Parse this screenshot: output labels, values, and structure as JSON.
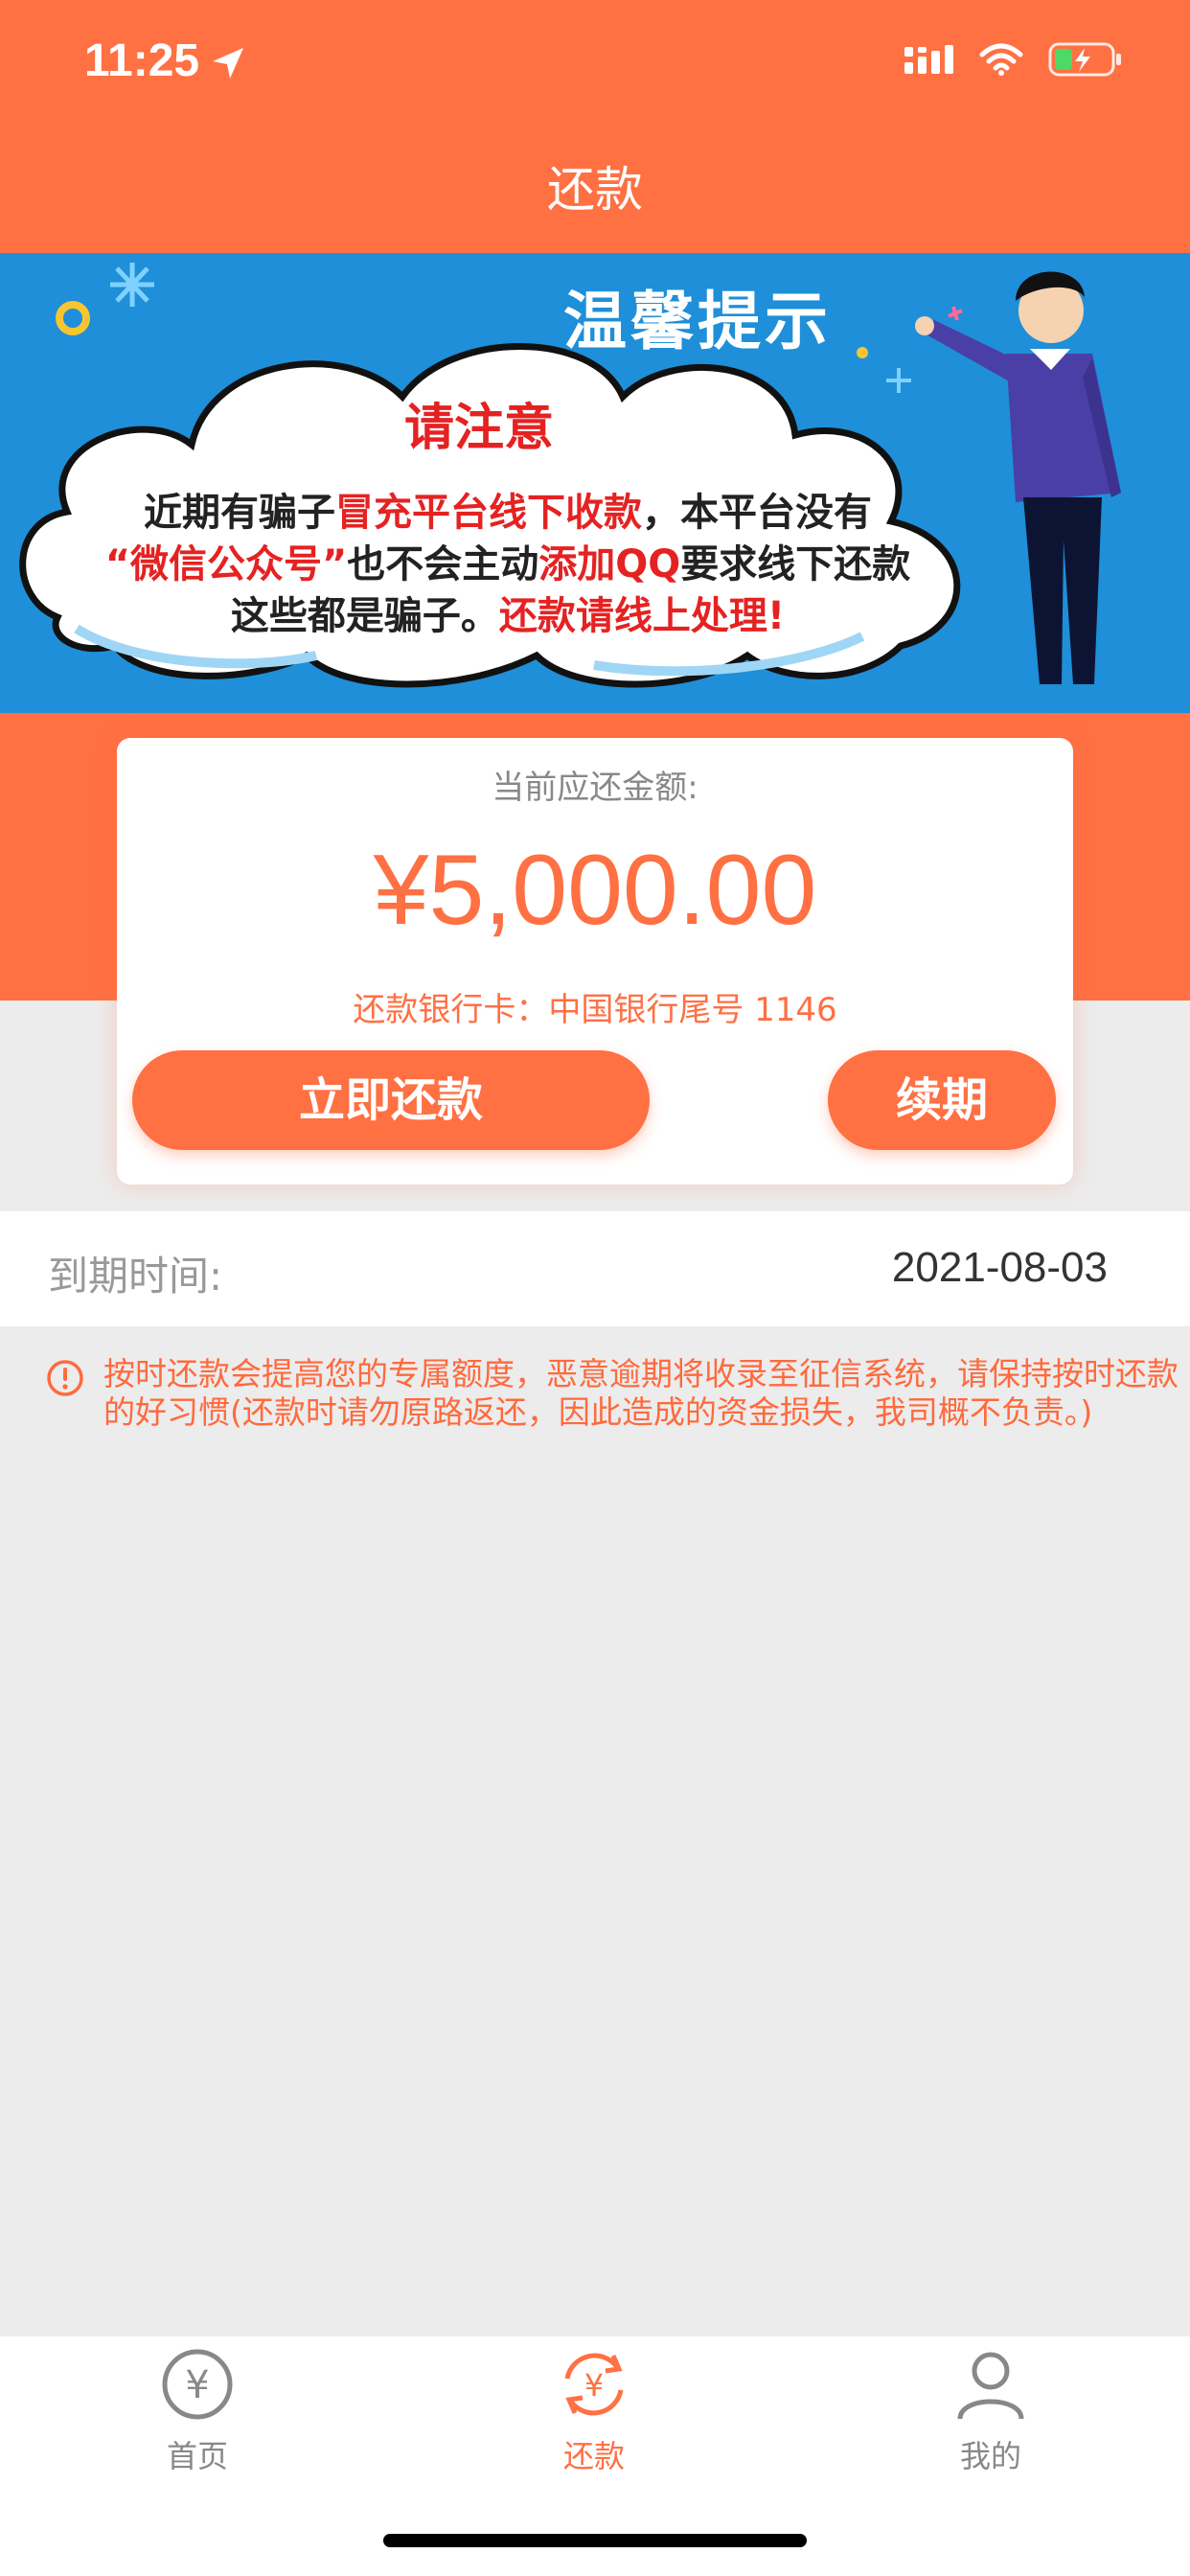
{
  "status": {
    "time": "11:25"
  },
  "nav": {
    "title": "还款"
  },
  "banner": {
    "title": "温馨提示",
    "heading": "请注意",
    "line1_a": "近期有骗子",
    "line1_b": "冒充平台线下收款",
    "line1_c": "，本平台没有",
    "line2_a": "“微信公众号”",
    "line2_b": "也不会主动",
    "line2_c": "添加QQ",
    "line2_d": "要求线下还款",
    "line3_a": "这些都是骗子。",
    "line3_b": "还款请线上处理!"
  },
  "card": {
    "label": "当前应还金额:",
    "amount": "¥5,000.00",
    "bank": "还款银行卡：中国银行尾号 1146",
    "pay_button": "立即还款",
    "renew_button": "续期"
  },
  "due": {
    "label": "到期时间:",
    "value": "2021-08-03"
  },
  "notice": {
    "text": "按时还款会提高您的专属额度，恶意逾期将收录至征信系统，请保持按时还款的好习惯(还款时请勿原路返还，因此造成的资金损失，我司概不负责。)"
  },
  "tabs": [
    {
      "label": "首页",
      "icon": "yen-circle-icon"
    },
    {
      "label": "还款",
      "icon": "repay-cycle-icon"
    },
    {
      "label": "我的",
      "icon": "user-icon"
    }
  ],
  "colors": {
    "accent": "#ff7043",
    "banner_blue": "#1e8fd8",
    "warn_red": "#e52222"
  }
}
